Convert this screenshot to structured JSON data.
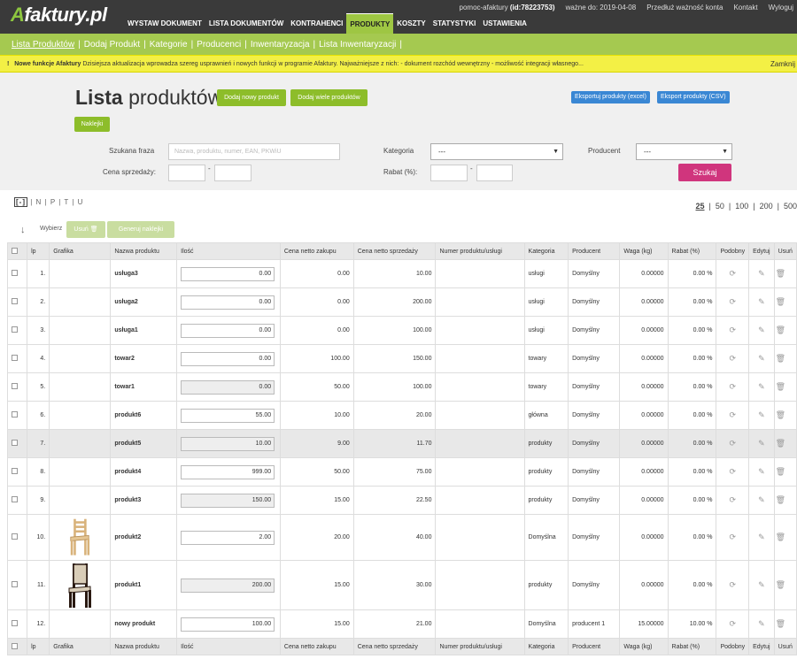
{
  "brand": {
    "first": "A",
    "rest": "faktury.pl"
  },
  "util": {
    "user": "pomoc-afaktury",
    "id": "(id:78223753)",
    "valid_label": "ważne do:",
    "valid_date": "2019-04-08",
    "extend": "Przedłuż ważność konta",
    "contact": "Kontakt",
    "logout": "Wyloguj"
  },
  "nav": [
    "WYSTAW DOKUMENT",
    "LISTA DOKUMENTÓW",
    "KONTRAHENCI",
    "PRODUKTY",
    "KOSZTY",
    "STATYSTYKI",
    "USTAWIENIA"
  ],
  "subnav": [
    "Lista Produktów",
    "Dodaj Produkt",
    "Kategorie",
    "Producenci",
    "Inwentaryzacja",
    "Lista Inwentaryzacji"
  ],
  "notice": {
    "icon": "!",
    "bold": "Nowe funkcje Afaktury",
    "text": "Dzisiejsza aktualizacja wprowadza szereg usprawnień i nowych funkcji w programie Afaktury. Najważniejsze z nich: - dokument rozchód wewnętrzny - możliwość integracji własnego...",
    "close": "Zamknij"
  },
  "page": {
    "title_bold": "Lista",
    "title_rest": " produktów",
    "add_new": "Dodaj nowy produkt",
    "add_many": "Dodaj wiele produktów",
    "export_excel": "Eksportuj produkty (excel)",
    "export_csv": "Eksport produkty (CSV)",
    "labels_btn": "Naklejki"
  },
  "filters": {
    "phrase_label": "Szukana fraza",
    "phrase_placeholder": "Nazwa, produktu, numer, EAN, PKWiU",
    "category_label": "Kategoria",
    "category_value": "---",
    "producer_label": "Producent",
    "producer_value": "---",
    "price_label": "Cena sprzedaży:",
    "dash": "-",
    "discount_label": "Rabat (%):",
    "search": "Szukaj"
  },
  "columns_toggle": {
    "box": "[-]",
    "rest": " | N | P | T | U"
  },
  "pager": [
    "25",
    "50",
    "100",
    "200",
    "500"
  ],
  "bulk": {
    "arrow": "↓",
    "choose": "Wybierz",
    "delete": "Usuń",
    "generate": "Generuj naklejki"
  },
  "table": {
    "headers": [
      "",
      "lp",
      "Grafika",
      "Nazwa produktu",
      "Ilość",
      "Cena netto zakupu",
      "Cena netto sprzedaży",
      "Numer produktu/usługi",
      "Kategoria",
      "Producent",
      "Waga (kg)",
      "Rabat (%)",
      "Podobny",
      "Edytuj",
      "Usuń"
    ],
    "rows": [
      {
        "lp": "1.",
        "name": "usługa3",
        "qty": "0.00",
        "buy": "0.00",
        "sell": "10.00",
        "num": "",
        "cat": "usługi",
        "prod": "Domyślny",
        "weight": "0.00000",
        "disc": "0.00 %",
        "img": "",
        "ro": false,
        "hl": false
      },
      {
        "lp": "2.",
        "name": "usługa2",
        "qty": "0.00",
        "buy": "0.00",
        "sell": "200.00",
        "num": "",
        "cat": "usługi",
        "prod": "Domyślny",
        "weight": "0.00000",
        "disc": "0.00 %",
        "img": "",
        "ro": false,
        "hl": false
      },
      {
        "lp": "3.",
        "name": "usługa1",
        "qty": "0.00",
        "buy": "0.00",
        "sell": "100.00",
        "num": "",
        "cat": "usługi",
        "prod": "Domyślny",
        "weight": "0.00000",
        "disc": "0.00 %",
        "img": "",
        "ro": false,
        "hl": false
      },
      {
        "lp": "4.",
        "name": "towar2",
        "qty": "0.00",
        "buy": "100.00",
        "sell": "150.00",
        "num": "",
        "cat": "towary",
        "prod": "Domyślny",
        "weight": "0.00000",
        "disc": "0.00 %",
        "img": "",
        "ro": false,
        "hl": false
      },
      {
        "lp": "5.",
        "name": "towar1",
        "qty": "0.00",
        "buy": "50.00",
        "sell": "100.00",
        "num": "",
        "cat": "towary",
        "prod": "Domyślny",
        "weight": "0.00000",
        "disc": "0.00 %",
        "img": "",
        "ro": true,
        "hl": false
      },
      {
        "lp": "6.",
        "name": "produkt6",
        "qty": "55.00",
        "buy": "10.00",
        "sell": "20.00",
        "num": "",
        "cat": "główna",
        "prod": "Domyślny",
        "weight": "0.00000",
        "disc": "0.00 %",
        "img": "",
        "ro": false,
        "hl": false
      },
      {
        "lp": "7.",
        "name": "produkt5",
        "qty": "10.00",
        "buy": "9.00",
        "sell": "11.70",
        "num": "",
        "cat": "produkty",
        "prod": "Domyślny",
        "weight": "0.00000",
        "disc": "0.00 %",
        "img": "",
        "ro": true,
        "hl": true
      },
      {
        "lp": "8.",
        "name": "produkt4",
        "qty": "999.00",
        "buy": "50.00",
        "sell": "75.00",
        "num": "",
        "cat": "produkty",
        "prod": "Domyślny",
        "weight": "0.00000",
        "disc": "0.00 %",
        "img": "",
        "ro": false,
        "hl": false
      },
      {
        "lp": "9.",
        "name": "produkt3",
        "qty": "150.00",
        "buy": "15.00",
        "sell": "22.50",
        "num": "",
        "cat": "produkty",
        "prod": "Domyślny",
        "weight": "0.00000",
        "disc": "0.00 %",
        "img": "",
        "ro": true,
        "hl": false
      },
      {
        "lp": "10.",
        "name": "produkt2",
        "qty": "2.00",
        "buy": "20.00",
        "sell": "40.00",
        "num": "",
        "cat": "Domyślna",
        "prod": "Domyślny",
        "weight": "0.00000",
        "disc": "0.00 %",
        "img": "light-chair",
        "ro": false,
        "hl": false
      },
      {
        "lp": "11.",
        "name": "produkt1",
        "qty": "200.00",
        "buy": "15.00",
        "sell": "30.00",
        "num": "",
        "cat": "produkty",
        "prod": "Domyślny",
        "weight": "0.00000",
        "disc": "0.00 %",
        "img": "dark-chair",
        "ro": true,
        "hl": false
      },
      {
        "lp": "12.",
        "name": "nowy produkt",
        "qty": "100.00",
        "buy": "15.00",
        "sell": "21.00",
        "num": "",
        "cat": "Domyślna",
        "prod": "producent 1",
        "weight": "15.00000",
        "disc": "10.00 %",
        "img": "",
        "ro": false,
        "hl": false
      }
    ]
  },
  "icons": {
    "similar": "refresh-icon",
    "edit": "edit-icon",
    "delete": "trash-icon"
  }
}
